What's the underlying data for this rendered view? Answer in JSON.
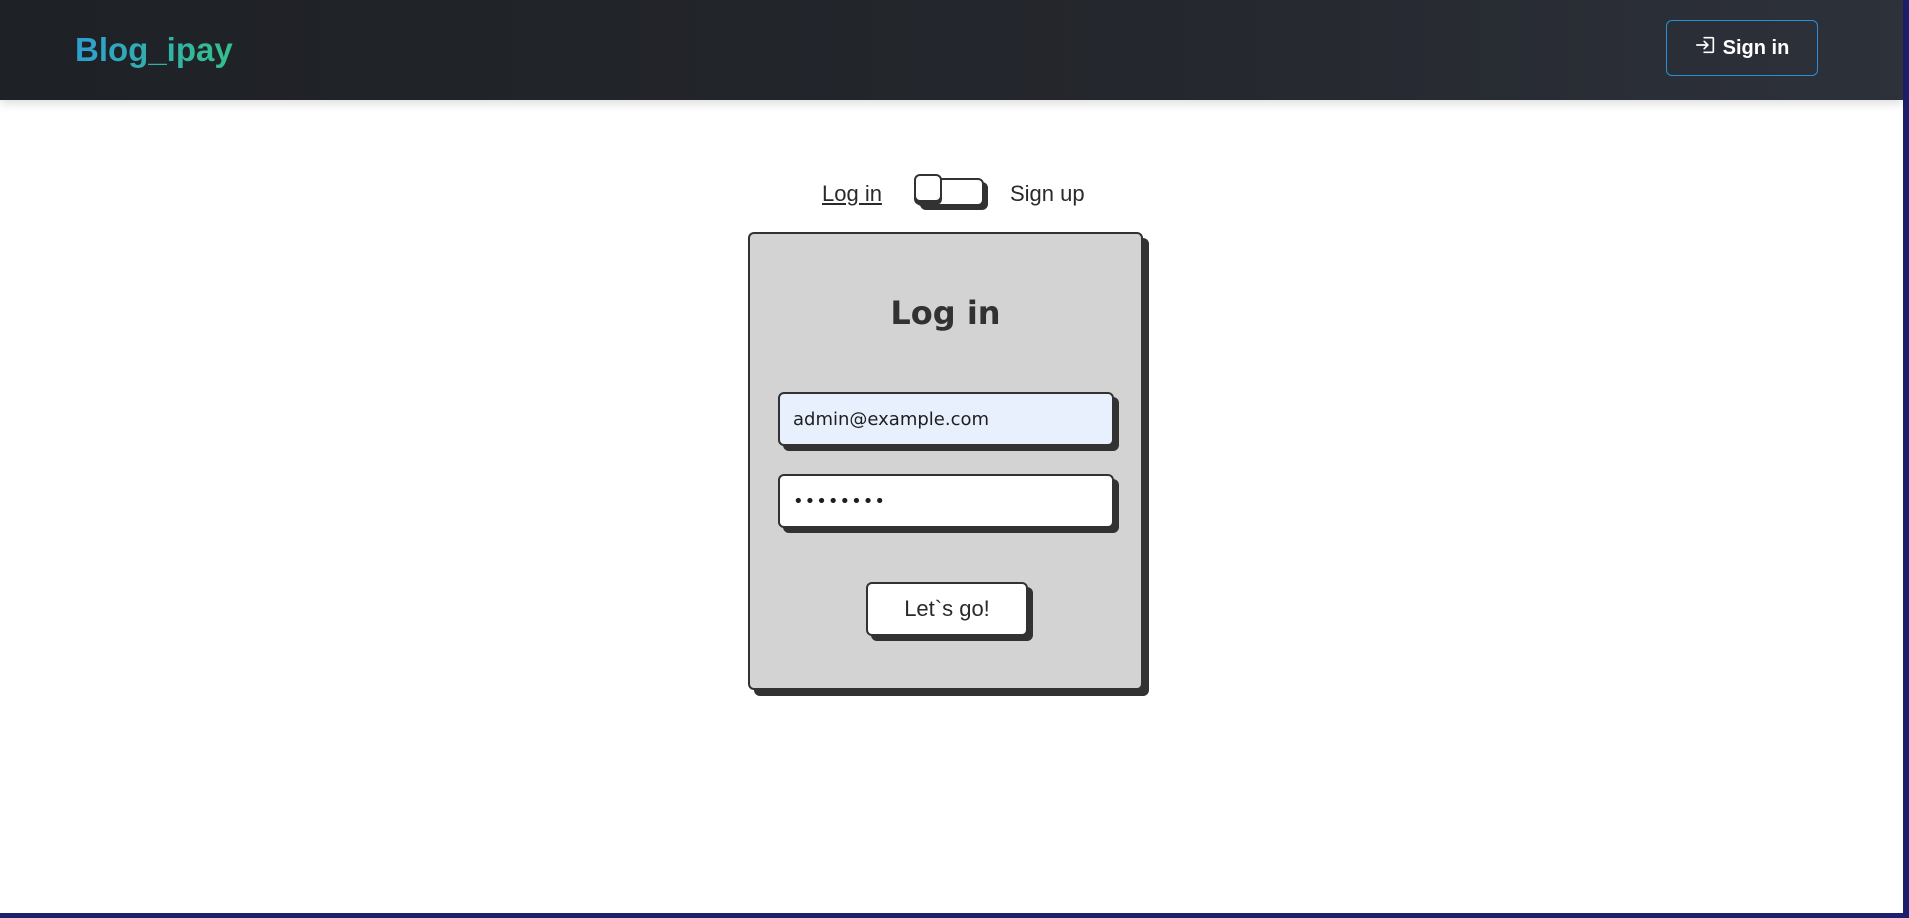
{
  "navbar": {
    "brand": "Blog_ipay",
    "signin_label": "Sign in",
    "signin_icon": "sign-in-icon"
  },
  "auth_switch": {
    "login_label": "Log in",
    "signup_label": "Sign up",
    "mode": "login"
  },
  "login_form": {
    "title": "Log in",
    "email_value": "admin@example.com",
    "password_value": "••••••••",
    "submit_label": "Let`s go!"
  },
  "colors": {
    "navbar_bg": "#212429",
    "brand_gradient_start": "#2f9fd0",
    "brand_gradient_end": "#34c08a",
    "card_bg": "#d3d3d3",
    "border": "#323232",
    "autofill_bg": "#e8f0fe"
  }
}
